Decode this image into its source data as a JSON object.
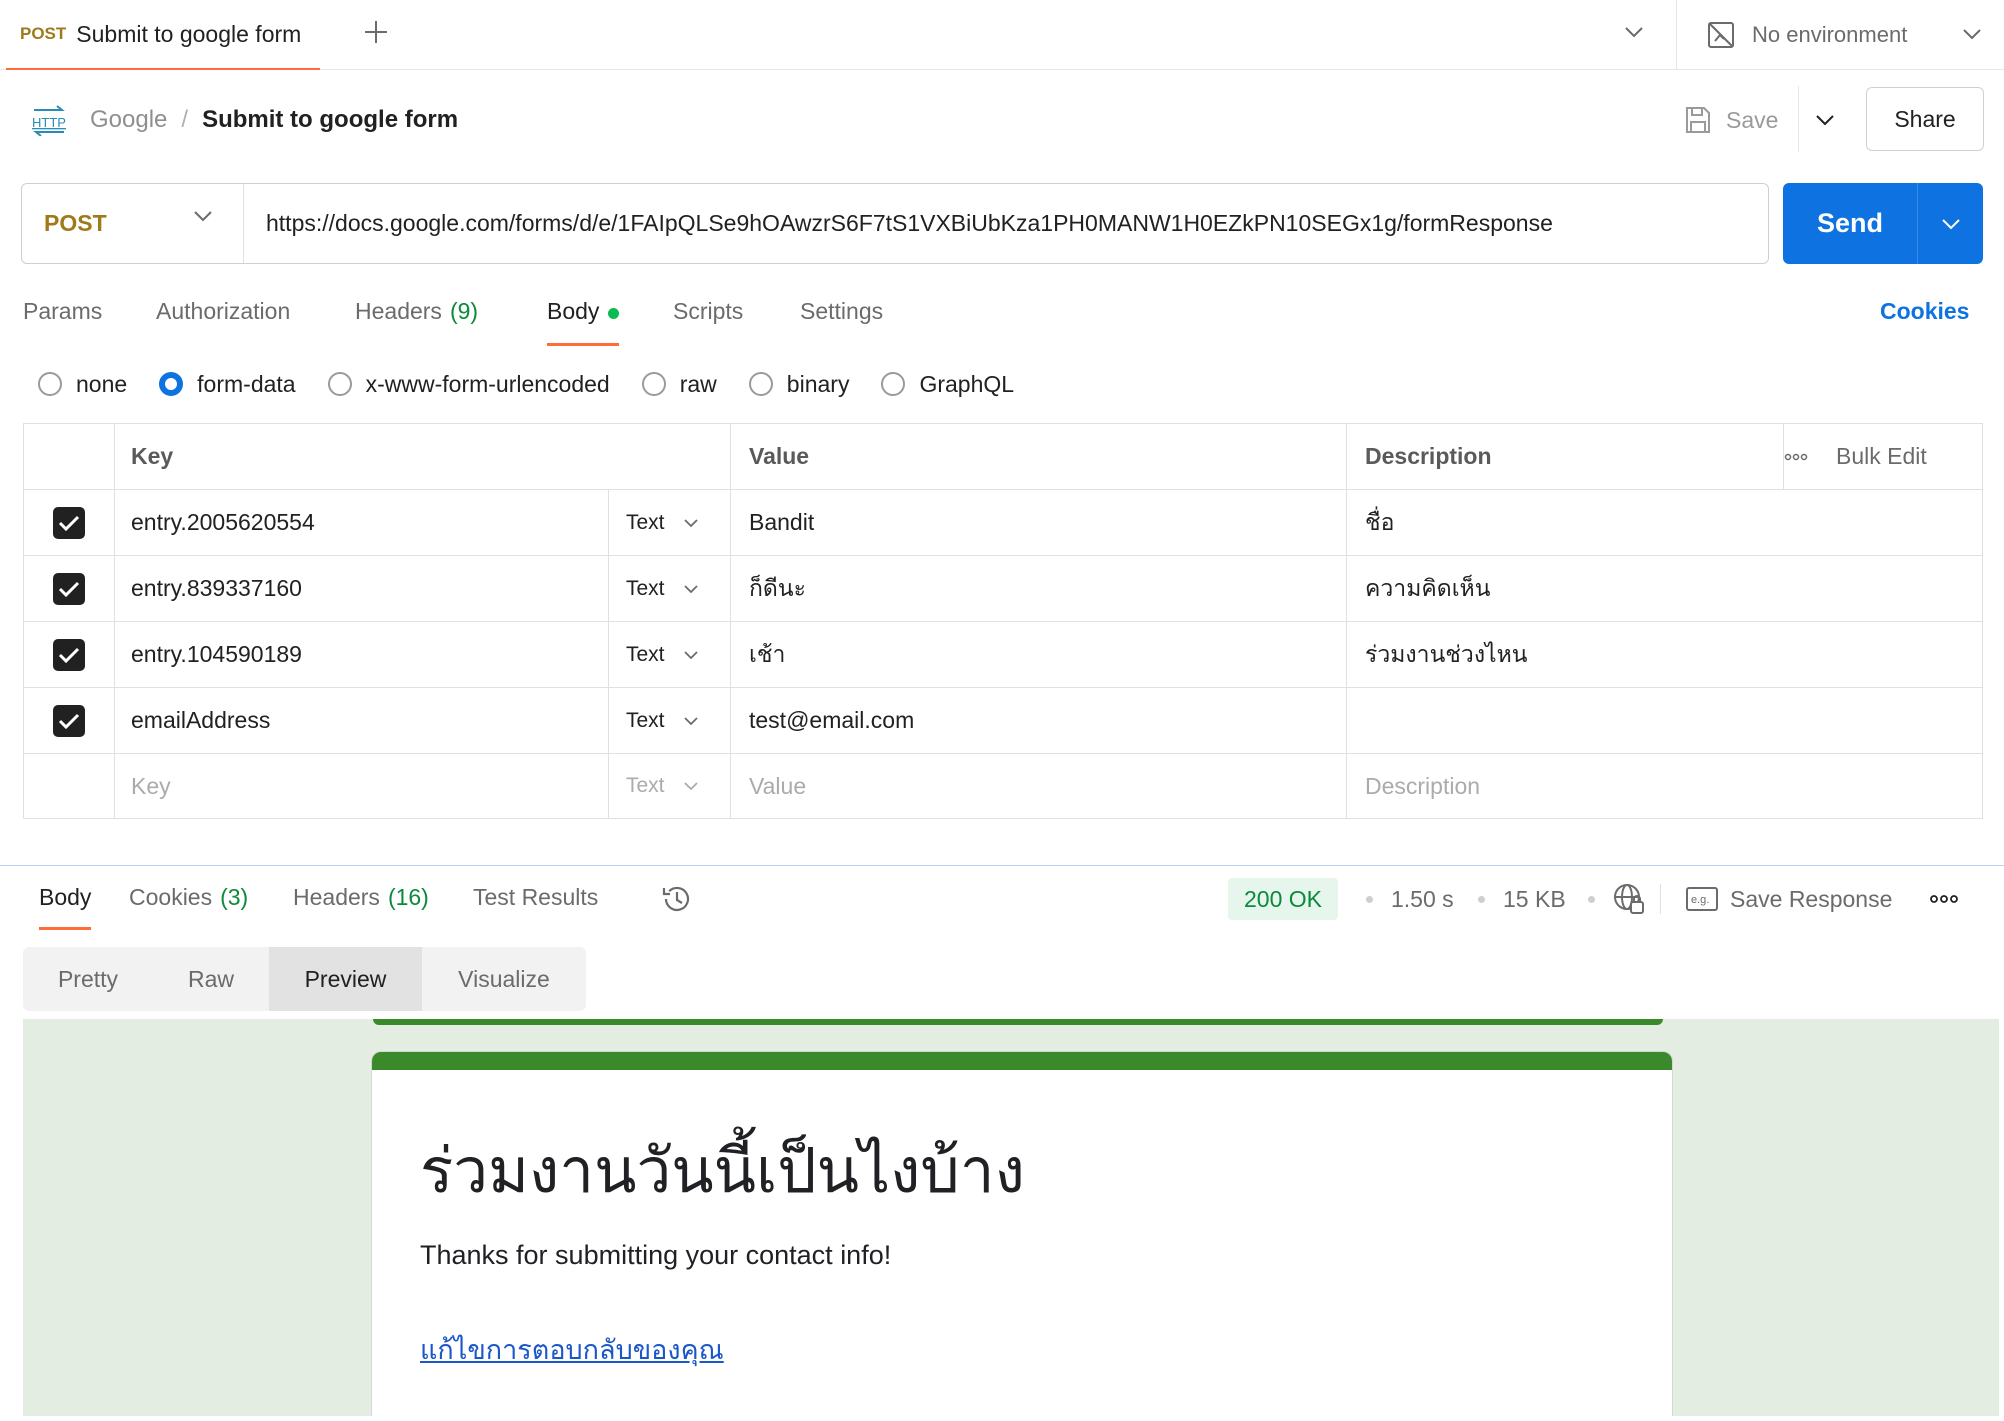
{
  "tab": {
    "method": "POST",
    "name": "Submit to google form"
  },
  "environment": {
    "label": "No environment"
  },
  "breadcrumb": {
    "collection": "Google",
    "separator": "/",
    "request": "Submit to google form"
  },
  "header_actions": {
    "save_label": "Save",
    "share_label": "Share"
  },
  "request": {
    "method": "POST",
    "url": "https://docs.google.com/forms/d/e/1FAIpQLSe9hOAwzrS6F7tS1VXBiUbKza1PH0MANW1H0EZkPN10SEGx1g/formResponse",
    "send_label": "Send"
  },
  "request_tabs": [
    {
      "label": "Params",
      "count": ""
    },
    {
      "label": "Authorization",
      "count": ""
    },
    {
      "label": "Headers",
      "count": "(9)"
    },
    {
      "label": "Body",
      "count": ""
    },
    {
      "label": "Scripts",
      "count": ""
    },
    {
      "label": "Settings",
      "count": ""
    }
  ],
  "cookies_link": "Cookies",
  "body_types": [
    {
      "label": "none",
      "checked": false
    },
    {
      "label": "form-data",
      "checked": true
    },
    {
      "label": "x-www-form-urlencoded",
      "checked": false
    },
    {
      "label": "raw",
      "checked": false
    },
    {
      "label": "binary",
      "checked": false
    },
    {
      "label": "GraphQL",
      "checked": false
    }
  ],
  "form_table": {
    "headers": {
      "key": "Key",
      "value": "Value",
      "description": "Description",
      "bulk_edit": "Bulk Edit"
    },
    "rows": [
      {
        "key": "entry.2005620554",
        "type": "Text",
        "value": "Bandit",
        "description": "ชื่อ"
      },
      {
        "key": "entry.839337160",
        "type": "Text",
        "value": "ก็ดีนะ",
        "description": "ความคิดเห็น"
      },
      {
        "key": "entry.104590189",
        "type": "Text",
        "value": "เช้า",
        "description": "ร่วมงานช่วงไหน"
      },
      {
        "key": "emailAddress",
        "type": "Text",
        "value": "test@email.com",
        "description": ""
      }
    ],
    "placeholder": {
      "key": "Key",
      "type": "Text",
      "value": "Value",
      "description": "Description"
    }
  },
  "response_tabs": [
    {
      "label": "Body",
      "count": ""
    },
    {
      "label": "Cookies",
      "count": "(3)"
    },
    {
      "label": "Headers",
      "count": "(16)"
    },
    {
      "label": "Test Results",
      "count": ""
    }
  ],
  "response_meta": {
    "status": "200 OK",
    "time": "1.50 s",
    "size": "15 KB",
    "save_response": "Save Response"
  },
  "view_modes": [
    "Pretty",
    "Raw",
    "Preview",
    "Visualize"
  ],
  "active_view": "Preview",
  "preview": {
    "title": "ร่วมงานวันนี้เป็นไงบ้าง",
    "message": "Thanks for submitting your contact info!",
    "edit_link": "แก้ไขการตอบกลับของคุณ"
  },
  "colors": {
    "accent": "#ff6c37",
    "primary": "#0e72e0",
    "method": "#a0791a",
    "success": "#0b8a3c",
    "form_green": "#3a8a2c"
  }
}
